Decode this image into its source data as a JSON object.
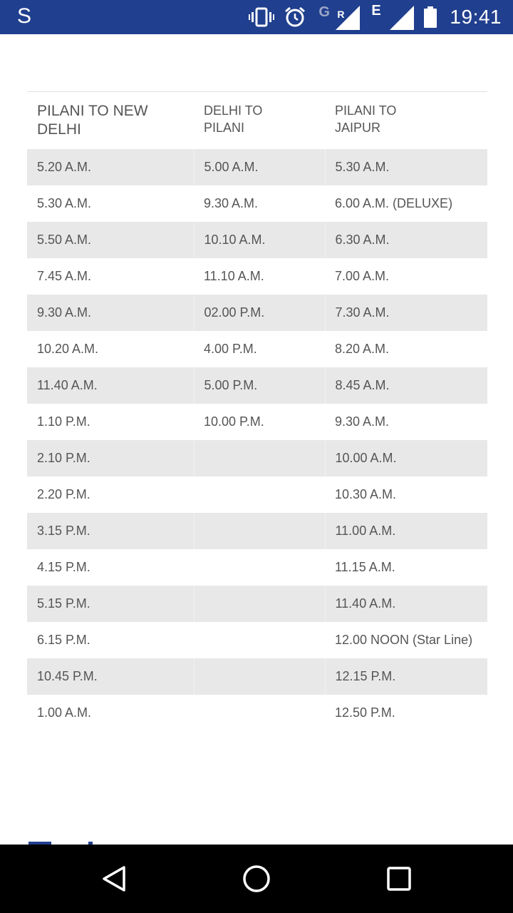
{
  "status_bar": {
    "app_letter": "S",
    "network_g": "G",
    "roaming_r": "R",
    "network_e": "E",
    "time": "19:41"
  },
  "table": {
    "headers": [
      "PILANI TO NEW DELHI",
      "DELHI TO PILANI",
      "PILANI TO JAIPUR"
    ],
    "rows": [
      [
        "5.20 A.M.",
        "5.00 A.M.",
        "5.30 A.M."
      ],
      [
        "5.30 A.M.",
        "9.30 A.M.",
        "6.00 A.M. (DELUXE)"
      ],
      [
        "5.50 A.M.",
        "10.10 A.M.",
        "6.30 A.M."
      ],
      [
        "7.45 A.M.",
        "11.10 A.M.",
        "7.00 A.M."
      ],
      [
        "9.30 A.M.",
        "02.00 P.M.",
        "7.30 A.M."
      ],
      [
        "10.20 A.M.",
        "4.00 P.M.",
        "8.20 A.M."
      ],
      [
        "11.40 A.M.",
        "5.00 P.M.",
        "8.45 A.M."
      ],
      [
        "1.10 P.M.",
        "10.00 P.M.",
        "9.30 A.M."
      ],
      [
        "2.10 P.M.",
        "",
        "10.00 A.M."
      ],
      [
        "2.20 P.M.",
        "",
        "10.30 A.M."
      ],
      [
        "3.15 P.M.",
        "",
        "11.00 A.M."
      ],
      [
        "4.15 P.M.",
        "",
        "11.15 A.M."
      ],
      [
        "5.15 P.M.",
        "",
        "11.40 A.M."
      ],
      [
        "6.15 P.M.",
        "",
        "12.00 NOON (Star Line)"
      ],
      [
        "10.45 P.M.",
        "",
        "12.15 P.M."
      ],
      [
        "1.00 A.M.",
        "",
        "12.50 P.M."
      ]
    ]
  },
  "colors": {
    "status_bar": "#203f8e",
    "row_shade": "#e8e8e8",
    "text": "#555555",
    "nav_bar": "#000000"
  },
  "nav": {
    "back_icon": "triangle-back-icon",
    "home_icon": "circle-home-icon",
    "recents_icon": "square-recents-icon"
  }
}
